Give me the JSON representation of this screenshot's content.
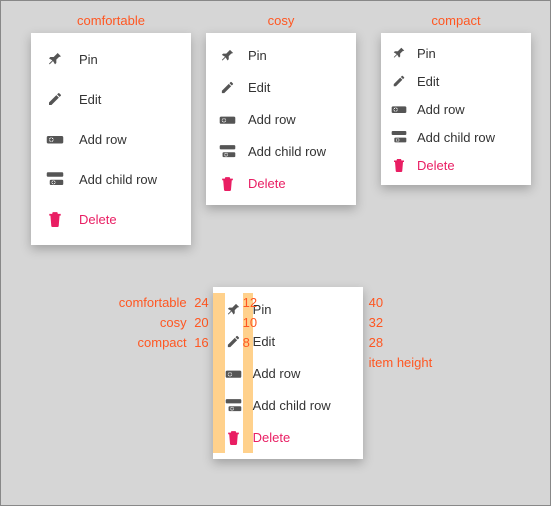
{
  "densities": {
    "comfortable": {
      "label": "comfortable",
      "left_pad": 24,
      "gap": 12,
      "item_h": 40
    },
    "cosy": {
      "label": "cosy",
      "left_pad": 20,
      "gap": 10,
      "item_h": 32
    },
    "compact": {
      "label": "compact",
      "left_pad": 16,
      "gap": 8,
      "item_h": 28
    }
  },
  "menu_items": {
    "pin": {
      "label": "Pin",
      "icon": "pin-icon"
    },
    "edit": {
      "label": "Edit",
      "icon": "pencil-icon"
    },
    "addrow": {
      "label": "Add row",
      "icon": "add-row-icon"
    },
    "addchild": {
      "label": "Add child row",
      "icon": "add-child-row-icon"
    },
    "delete": {
      "label": "Delete",
      "icon": "trash-icon",
      "danger": true
    }
  },
  "annot": {
    "item_height_label": "item height"
  }
}
